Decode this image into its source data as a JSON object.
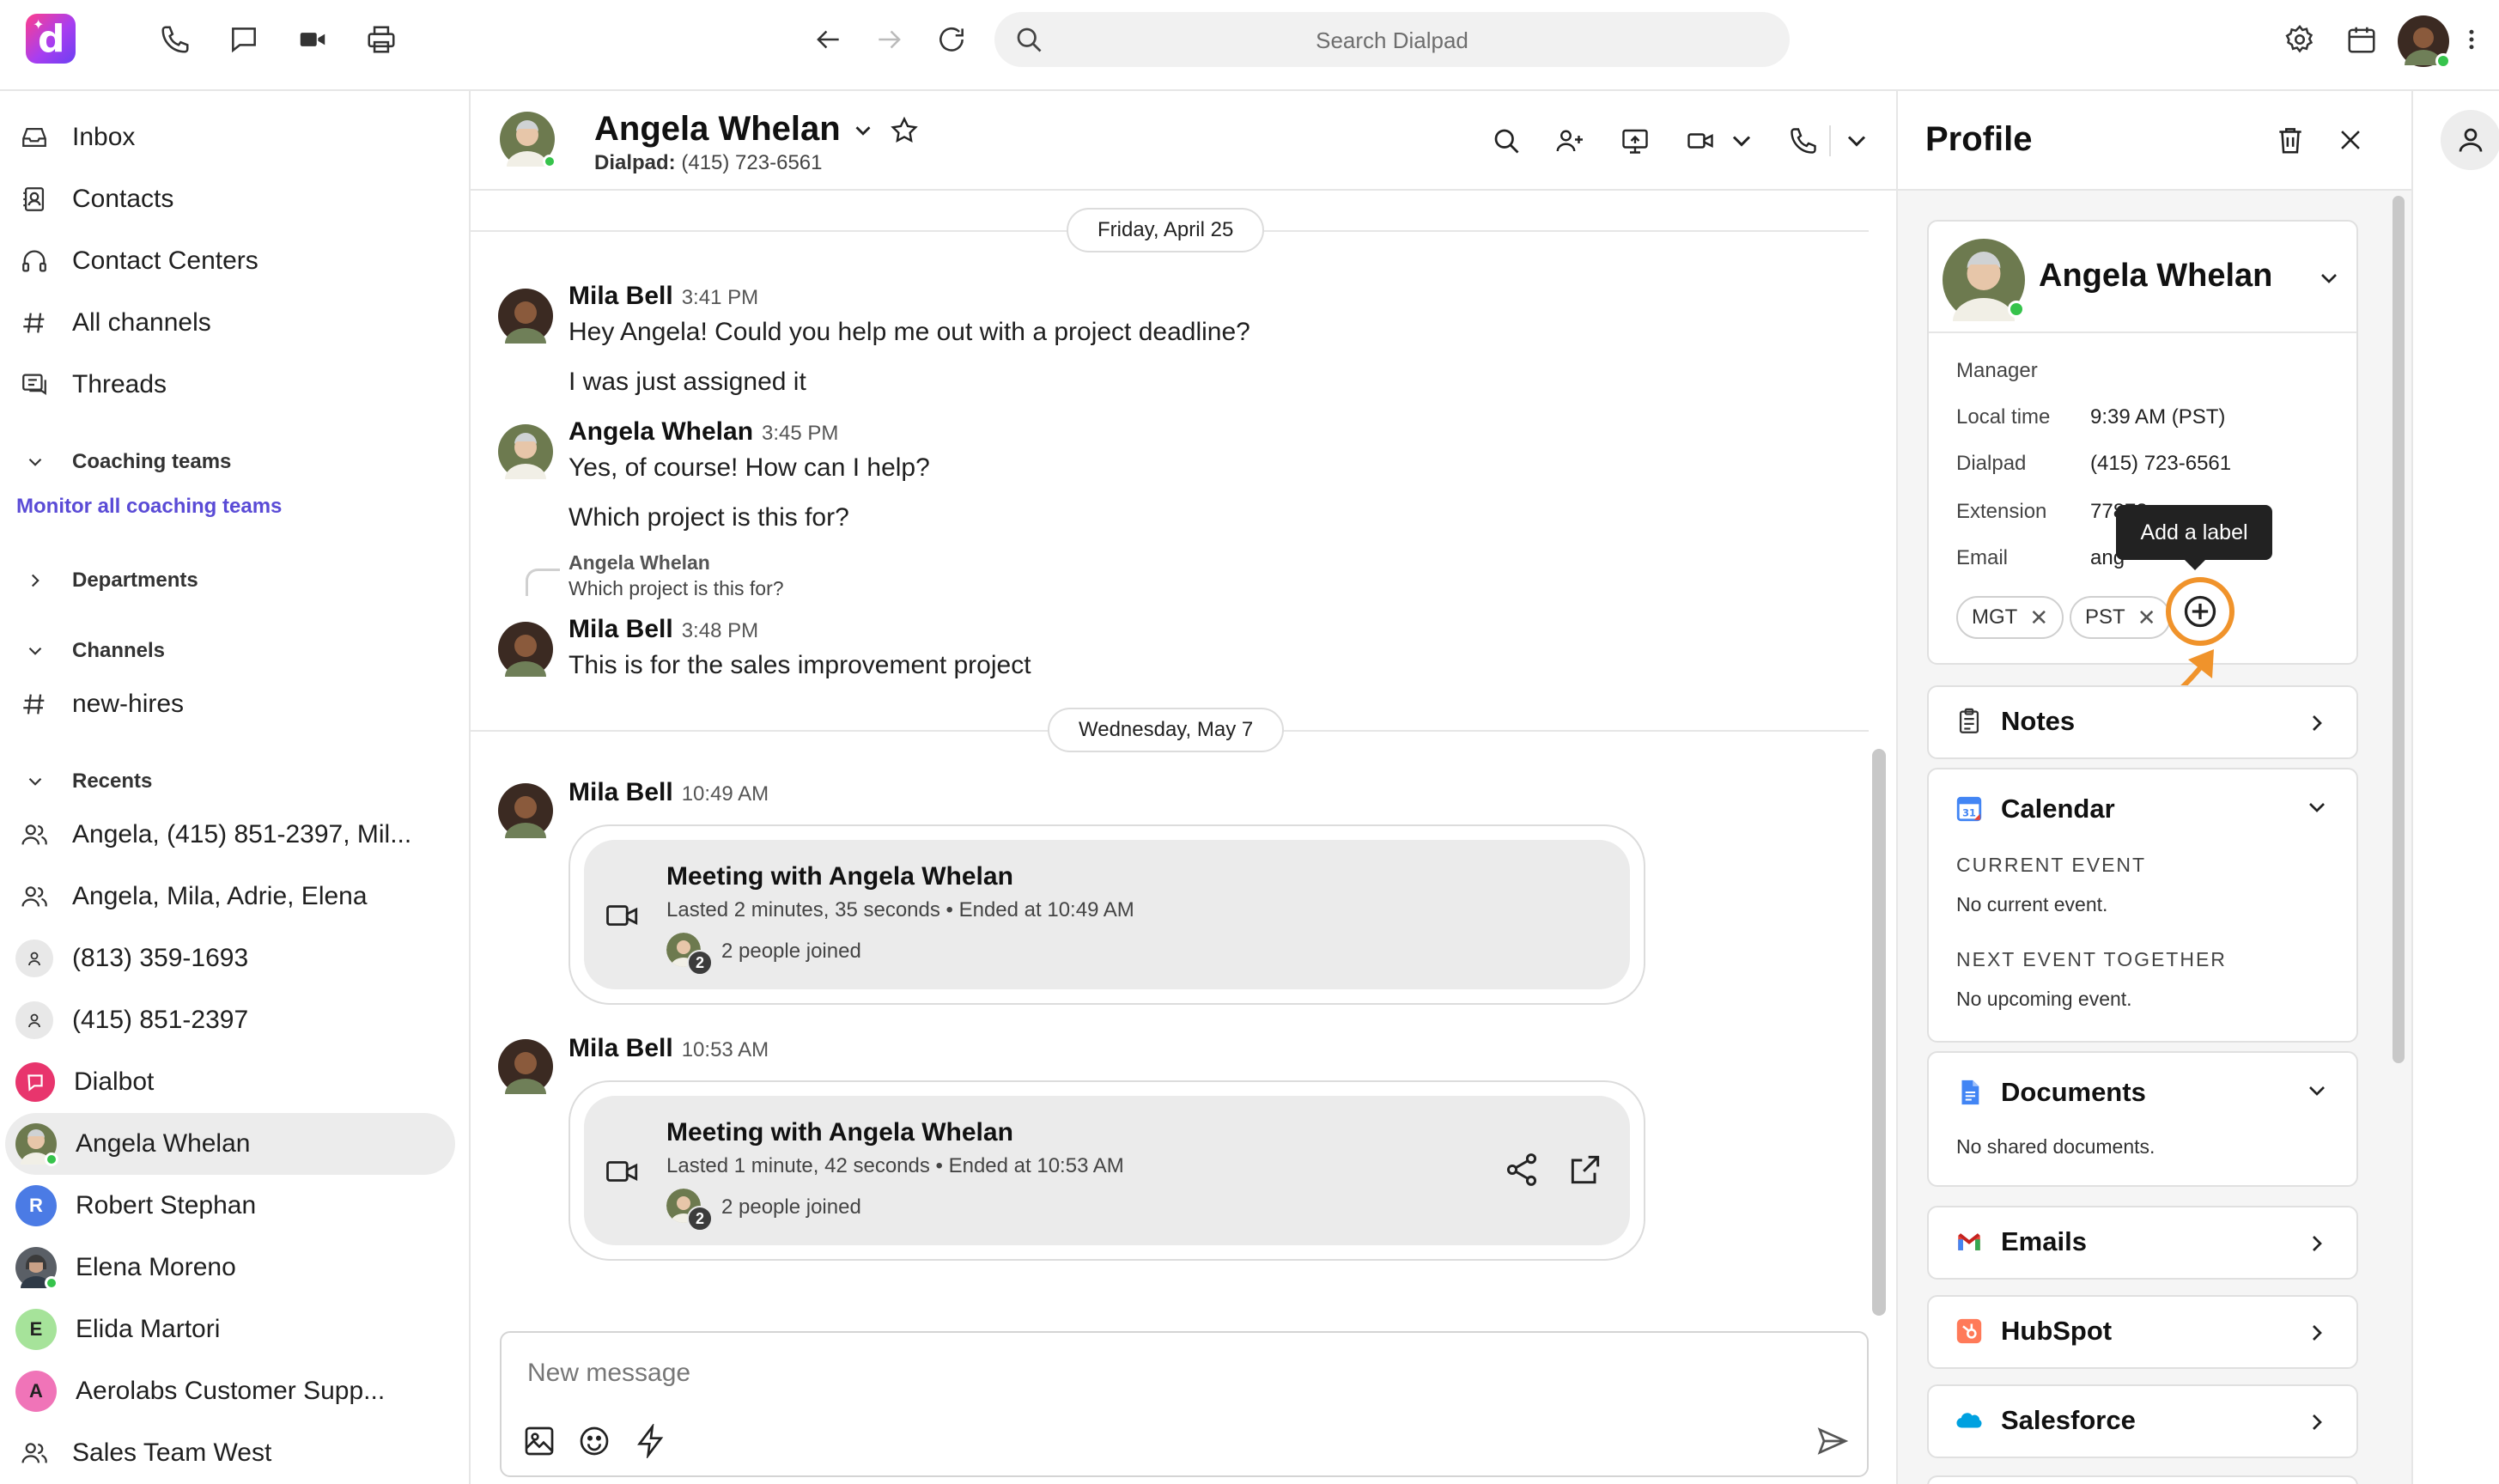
{
  "topbar": {
    "logo_letter": "d",
    "search_placeholder": "Search Dialpad"
  },
  "sidebar": {
    "nav": [
      {
        "label": "Inbox",
        "icon": "inbox-icon"
      },
      {
        "label": "Contacts",
        "icon": "contacts-icon"
      },
      {
        "label": "Contact Centers",
        "icon": "headset-icon"
      },
      {
        "label": "All channels",
        "icon": "hash-icon"
      },
      {
        "label": "Threads",
        "icon": "threads-icon"
      }
    ],
    "coaching_teams": "Coaching teams",
    "monitor_link": "Monitor all coaching teams",
    "departments": "Departments",
    "channels": "Channels",
    "channel_items": [
      {
        "label": "new-hires"
      }
    ],
    "recents": "Recents",
    "recent_items": [
      {
        "label": "Angela, (415) 851-2397, Mil...",
        "avatar": "group"
      },
      {
        "label": "Angela, Mila, Adrie, Elena",
        "avatar": "group"
      },
      {
        "label": "(813) 359-1693",
        "avatar": "person"
      },
      {
        "label": "(415) 851-2397",
        "avatar": "person"
      },
      {
        "label": "Dialbot",
        "avatar": "dialbot"
      },
      {
        "label": "Angela Whelan",
        "avatar": "photo",
        "online": true,
        "selected": true
      },
      {
        "label": "Robert Stephan",
        "avatar": "R",
        "avatar_color": "#4b7be5"
      },
      {
        "label": "Elena Moreno",
        "avatar": "photo2",
        "online": true
      },
      {
        "label": "Elida Martori",
        "avatar": "E",
        "avatar_color": "#a6e39a"
      },
      {
        "label": "Aerolabs Customer Supp...",
        "avatar": "A",
        "avatar_color": "#f074b8"
      },
      {
        "label": "Sales Team West",
        "avatar": "group"
      }
    ]
  },
  "conversation": {
    "name": "Angela Whelan",
    "sub_label": "Dialpad:",
    "sub_number": "(415) 723-6561",
    "dates": [
      "Friday, April 25",
      "Wednesday, May 7"
    ],
    "messages": [
      {
        "author": "Mila Bell",
        "time": "3:41 PM",
        "lines": [
          "Hey Angela! Could you help me out with a project deadline?",
          "I was just assigned it"
        ]
      },
      {
        "author": "Angela Whelan",
        "time": "3:45 PM",
        "lines": [
          "Yes, of course! How can I help?",
          "Which project is this for?"
        ]
      },
      {
        "reply_author": "Angela Whelan",
        "reply_text": "Which project is this for?",
        "author": "Mila Bell",
        "time": "3:48 PM",
        "lines": [
          "This is for the sales improvement project"
        ]
      },
      {
        "author": "Mila Bell",
        "time": "10:49 AM",
        "meeting": {
          "title": "Meeting with Angela Whelan",
          "sub": "Lasted 2 minutes, 35 seconds • Ended at 10:49 AM",
          "count": "2",
          "joined": "2 people joined"
        }
      },
      {
        "author": "Mila Bell",
        "time": "10:53 AM",
        "meeting": {
          "title": "Meeting with Angela Whelan",
          "sub": "Lasted 1 minute, 42 seconds • Ended at 10:53 AM",
          "count": "2",
          "joined": "2 people joined"
        }
      }
    ],
    "composer_placeholder": "New message"
  },
  "profile": {
    "title": "Profile",
    "name": "Angela Whelan",
    "role": "Manager",
    "fields": [
      {
        "label": "Local time",
        "value": "9:39 AM (PST)"
      },
      {
        "label": "Dialpad",
        "value": "(415) 723-6561"
      },
      {
        "label": "Extension",
        "value": "77878"
      },
      {
        "label": "Email",
        "value": "ang"
      }
    ],
    "tooltip": "Add a label",
    "labels": [
      "MGT",
      "PST"
    ],
    "notes": "Notes",
    "calendar": {
      "title": "Calendar",
      "current_event": "CURRENT EVENT",
      "current_none": "No current event.",
      "next_event": "NEXT EVENT TOGETHER",
      "next_none": "No upcoming event."
    },
    "documents": {
      "title": "Documents",
      "none": "No shared documents."
    },
    "emails": "Emails",
    "hubspot": "HubSpot",
    "salesforce": "Salesforce"
  },
  "colors": {
    "accent_orange": "#f0932b",
    "online_green": "#36c34b",
    "link_purple": "#5a4bd6"
  }
}
